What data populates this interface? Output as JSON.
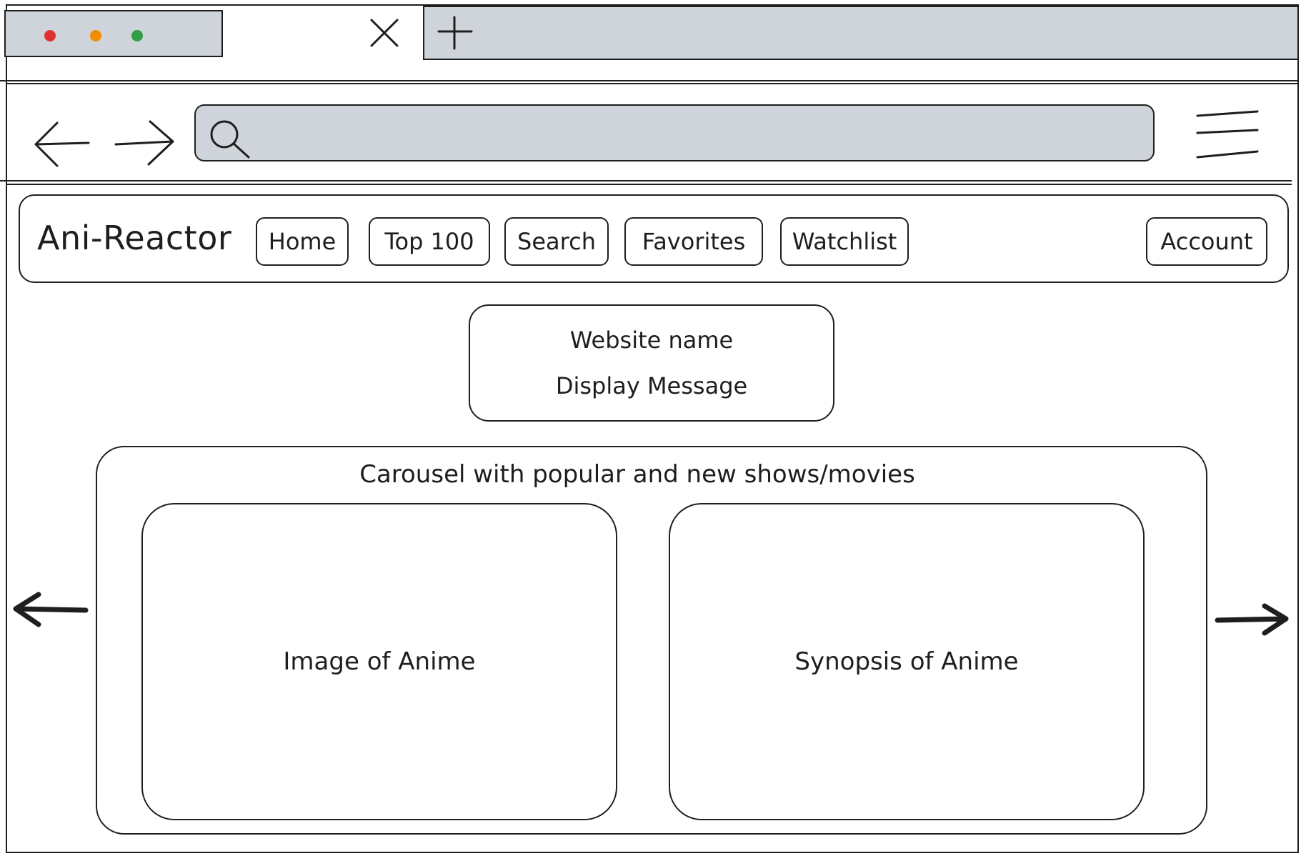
{
  "browser": {
    "window_controls": [
      {
        "name": "close",
        "color": "#e03131"
      },
      {
        "name": "minimize",
        "color": "#f08c00"
      },
      {
        "name": "maximize",
        "color": "#2f9e44"
      }
    ],
    "tab_close_icon": "close-icon",
    "new_tab_icon": "plus-icon",
    "back_icon": "arrow-left-icon",
    "forward_icon": "arrow-right-icon",
    "search_icon": "search-icon",
    "menu_icon": "hamburger-menu-icon"
  },
  "navbar": {
    "brand": "Ani-Reactor",
    "items": [
      {
        "label": "Home"
      },
      {
        "label": "Top 100"
      },
      {
        "label": "Search"
      },
      {
        "label": "Favorites"
      },
      {
        "label": "Watchlist"
      }
    ],
    "account": "Account"
  },
  "hero": {
    "line1": "Website name",
    "line2": "Display Message"
  },
  "carousel": {
    "title": "Carousel with popular and new shows/movies",
    "image_card": "Image of Anime",
    "synopsis_card": "Synopsis of Anime",
    "prev_icon": "arrow-left-icon",
    "next_icon": "arrow-right-icon"
  },
  "colors": {
    "stroke": "#1e1e1e",
    "chrome_fill": "#ced4da",
    "background": "#ffffff"
  }
}
